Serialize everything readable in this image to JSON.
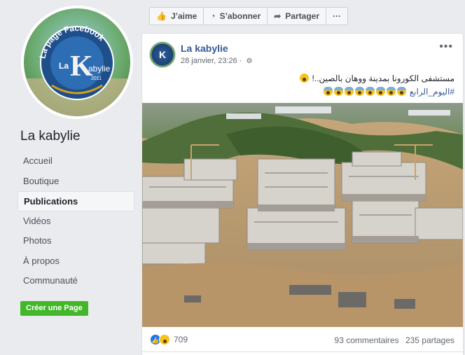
{
  "profile": {
    "logo_text_top": "La page Facebook",
    "logo_letter": "K",
    "logo_text_mid": "La",
    "logo_text_right": "abylie",
    "logo_year": "2011"
  },
  "page_name": "La kabylie",
  "nav": {
    "items": [
      {
        "label": "Accueil"
      },
      {
        "label": "Boutique"
      },
      {
        "label": "Publications"
      },
      {
        "label": "Vidéos"
      },
      {
        "label": "Photos"
      },
      {
        "label": "À propos"
      },
      {
        "label": "Communauté"
      }
    ],
    "create_page_label": "Créer une Page"
  },
  "actions": {
    "like_label": "J’aime",
    "subscribe_label": "S’abonner",
    "share_label": "Partager",
    "more_label": "···"
  },
  "post": {
    "author": "La kabylie",
    "avatar_letter": "K",
    "date": "28 janvier, 23:26",
    "text_line1": "مستشفى الكورونا بمدينة ووهان بالصين..!",
    "text_line2": "#اليوم_الرابع",
    "reaction_count": "709",
    "comments": "93 commentaires",
    "shares": "235 partages"
  },
  "colors": {
    "background": "#e9ebee",
    "link": "#385898",
    "create_button": "#42b72a",
    "like_blue": "#1877f2"
  }
}
